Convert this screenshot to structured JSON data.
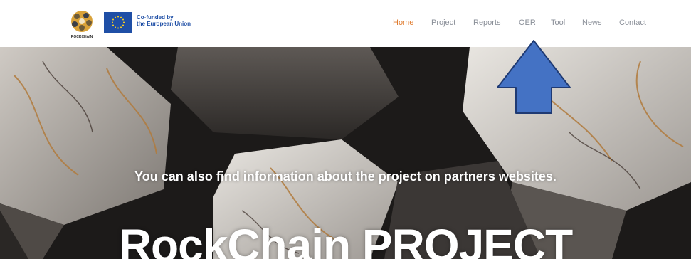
{
  "header": {
    "logo_text": "ROCKCHAIN",
    "eu_line1": "Co-funded by",
    "eu_line2": "the European Union"
  },
  "nav": {
    "items": [
      {
        "label": "Home",
        "active": true
      },
      {
        "label": "Project",
        "active": false
      },
      {
        "label": "Reports",
        "active": false
      },
      {
        "label": "OER",
        "active": false
      },
      {
        "label": "Tool",
        "active": false
      },
      {
        "label": "News",
        "active": false
      },
      {
        "label": "Contact",
        "active": false
      }
    ]
  },
  "hero": {
    "subtitle": "You can also find information about the project on partners websites.",
    "title": "RockChain PROJECT"
  },
  "colors": {
    "nav_active": "#e07b2e",
    "nav_inactive": "#8a8f98",
    "eu_blue": "#1f4fa6",
    "arrow_fill": "#4472c4",
    "arrow_stroke": "#1f3a73"
  },
  "icons": {
    "logo": "rockchain-logo-icon",
    "eu_flag": "eu-flag-icon",
    "annotation": "up-arrow-annotation-icon"
  }
}
